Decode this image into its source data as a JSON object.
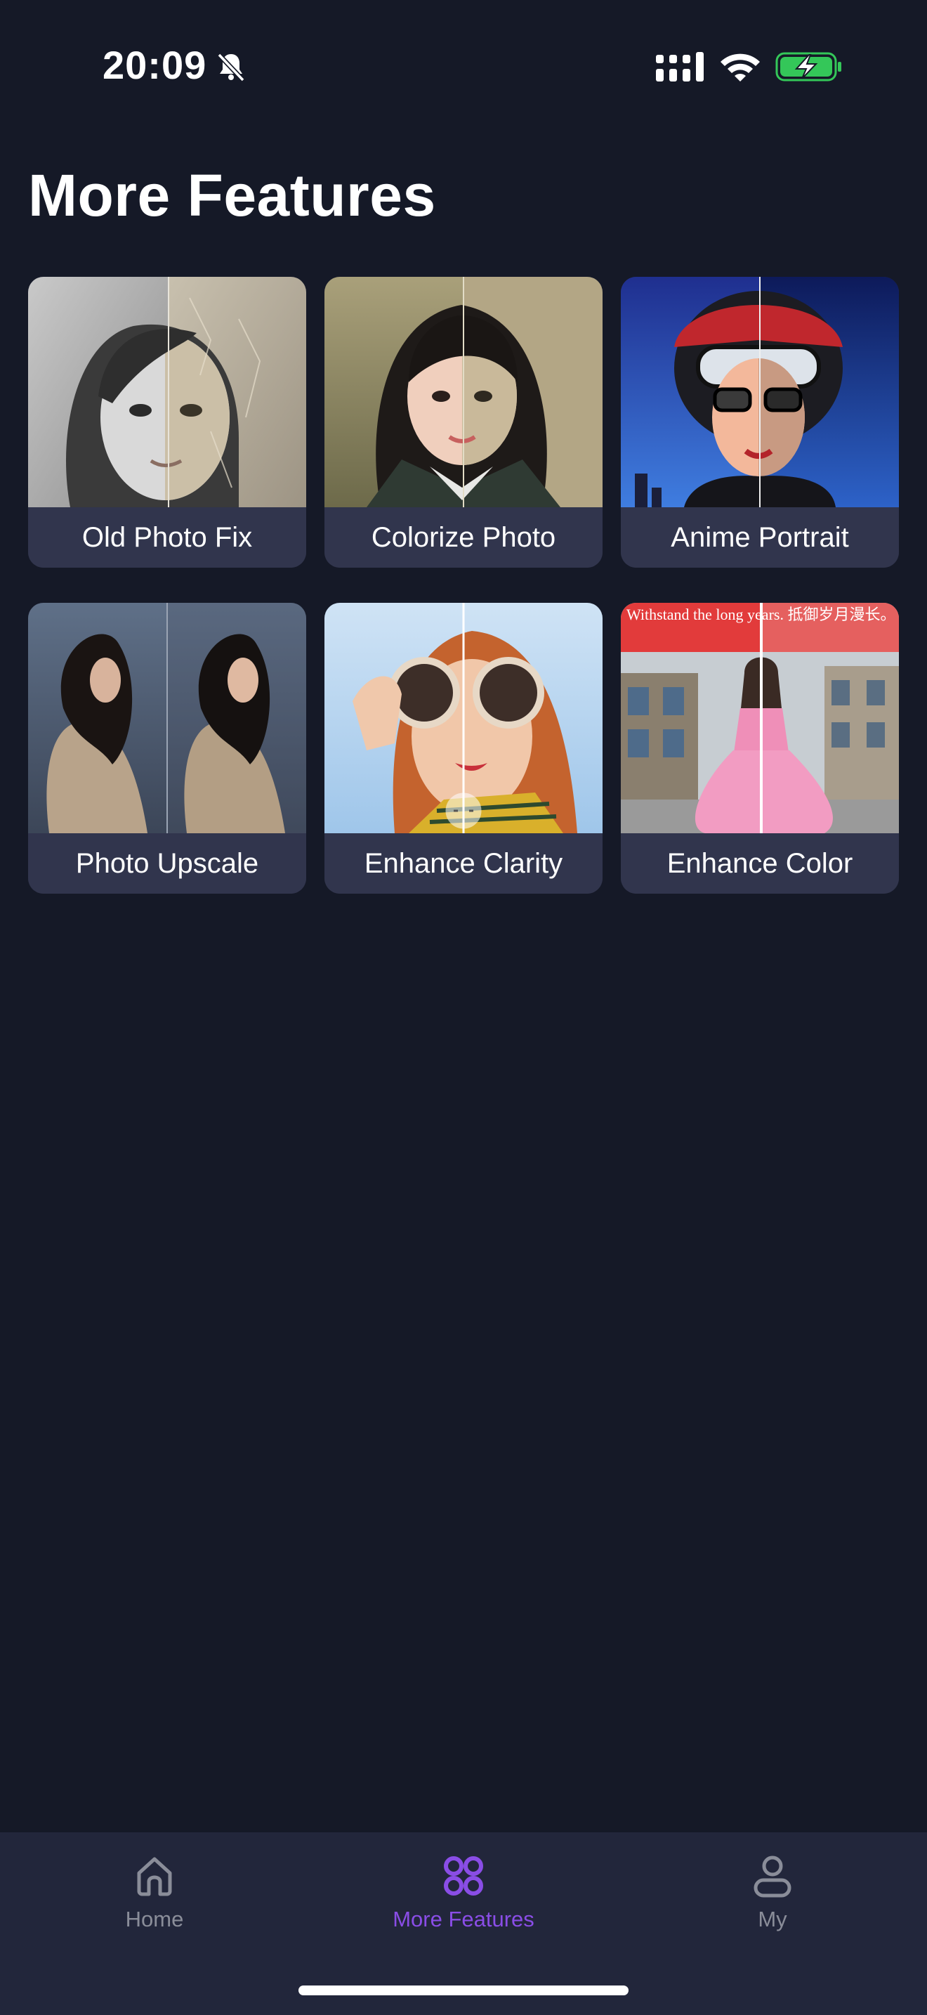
{
  "status_bar": {
    "time": "20:09",
    "icons": [
      "bell-slash-icon",
      "cellular-signal-icon",
      "wifi-icon",
      "battery-charging-icon"
    ]
  },
  "title": "More Features",
  "features": [
    {
      "label": "Old Photo Fix",
      "icon": "old-photo-fix-thumbnail"
    },
    {
      "label": "Colorize Photo",
      "icon": "colorize-photo-thumbnail"
    },
    {
      "label": "Anime Portrait",
      "icon": "anime-portrait-thumbnail"
    },
    {
      "label": "Photo Upscale",
      "icon": "photo-upscale-thumbnail"
    },
    {
      "label": "Enhance Clarity",
      "icon": "enhance-clarity-thumbnail"
    },
    {
      "label": "Enhance Color",
      "icon": "enhance-color-thumbnail"
    }
  ],
  "thumbnail_text": "Withstand the long years. 抵御岁月漫长。",
  "tab_bar": {
    "tabs": [
      {
        "label": "Home",
        "icon": "home-icon"
      },
      {
        "label": "More Features",
        "icon": "apps-icon",
        "active": true
      },
      {
        "label": "My",
        "icon": "person-icon"
      }
    ],
    "active_color": "#8a4de6",
    "inactive_color": "#8a8d99"
  },
  "colors": {
    "background": "#151927",
    "card": "#31354d",
    "tab_bar": "#22263b",
    "battery_green": "#34c759"
  }
}
